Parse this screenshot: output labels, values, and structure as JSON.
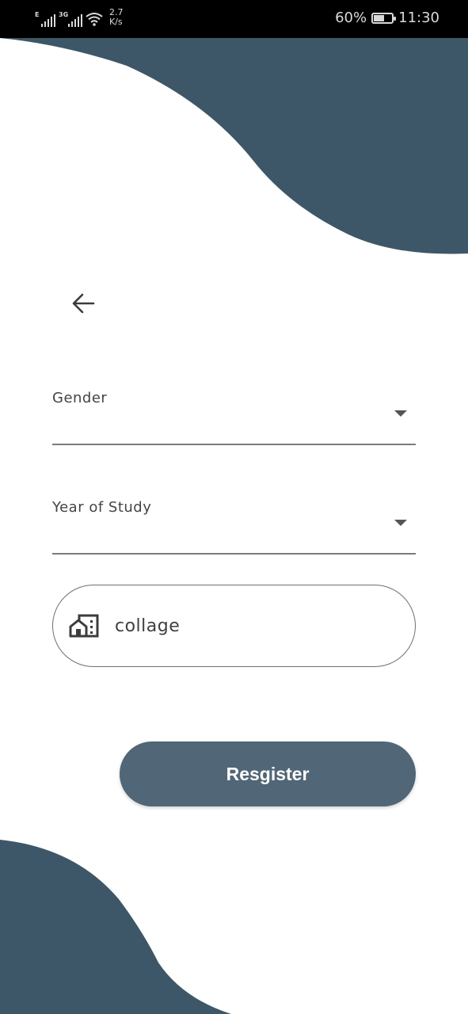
{
  "status_bar": {
    "network_1": "E",
    "network_2": "3G",
    "speed_value": "2.7",
    "speed_unit": "K/s",
    "battery": "60%",
    "time": "11:30"
  },
  "form": {
    "gender_label": "Gender",
    "year_label": "Year of Study",
    "college_value": "collage"
  },
  "actions": {
    "register_label": "Resgister"
  },
  "colors": {
    "accent": "#3e5768",
    "button": "#516676",
    "status_bar": "#000000",
    "underline": "#7b7b7b"
  },
  "icons": {
    "back": "arrow-left-icon",
    "college": "building-icon",
    "dropdown": "caret-down-icon"
  }
}
